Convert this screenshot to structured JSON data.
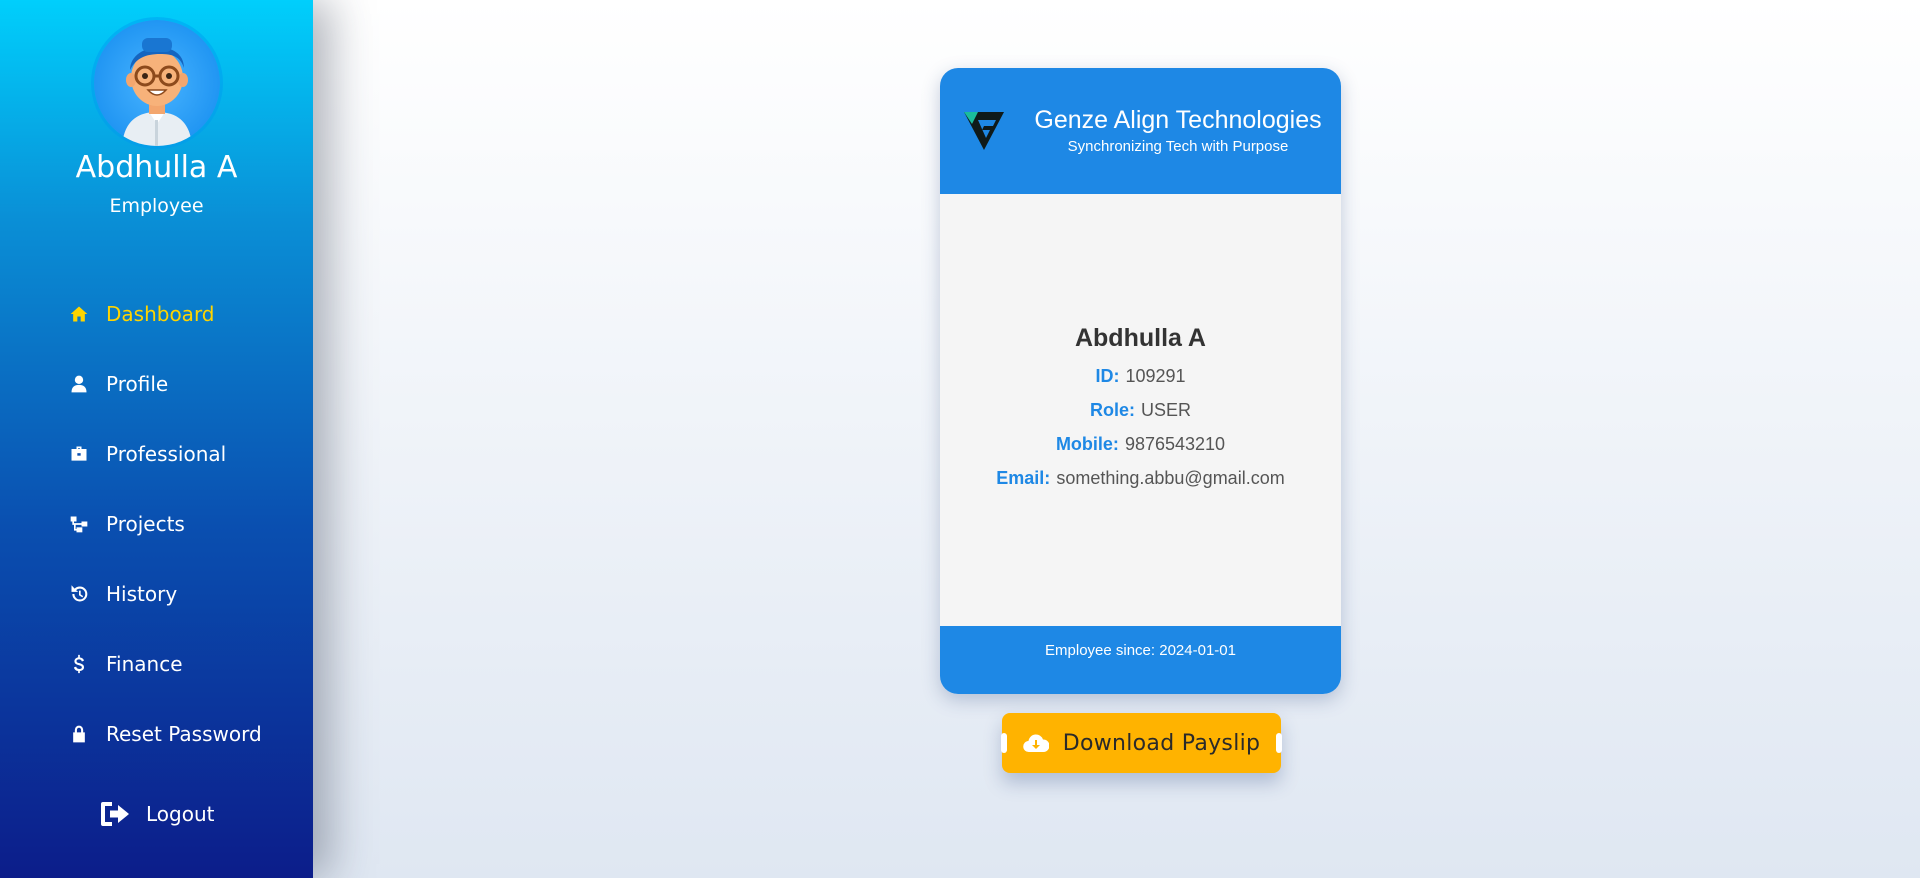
{
  "sidebar": {
    "user_name": "Abdhulla A",
    "user_role": "Employee",
    "items": [
      {
        "label": "Dashboard",
        "icon": "home-icon",
        "active": true
      },
      {
        "label": "Profile",
        "icon": "user-icon"
      },
      {
        "label": "Professional",
        "icon": "briefcase-icon"
      },
      {
        "label": "Projects",
        "icon": "sitemap-icon"
      },
      {
        "label": "History",
        "icon": "history-icon"
      },
      {
        "label": "Finance",
        "icon": "dollar-icon"
      },
      {
        "label": "Reset Password",
        "icon": "lock-icon"
      }
    ],
    "logout_label": "Logout",
    "active_color": "#ffd400"
  },
  "id_card": {
    "company_name": "Genze Align Technologies",
    "tagline": "Synchronizing Tech with Purpose",
    "employee_name": "Abdhulla A",
    "fields": [
      {
        "label": "ID:",
        "value": "109291"
      },
      {
        "label": "Role:",
        "value": "USER"
      },
      {
        "label": "Mobile:",
        "value": "9876543210"
      },
      {
        "label": "Email:",
        "value": "something.abbu@gmail.com"
      }
    ],
    "footer": "Employee since: 2024-01-01",
    "accent_color": "#1e88e5"
  },
  "download_button": {
    "label": "Download Payslip",
    "icon": "cloud-download-icon",
    "color": "#ffb300"
  }
}
